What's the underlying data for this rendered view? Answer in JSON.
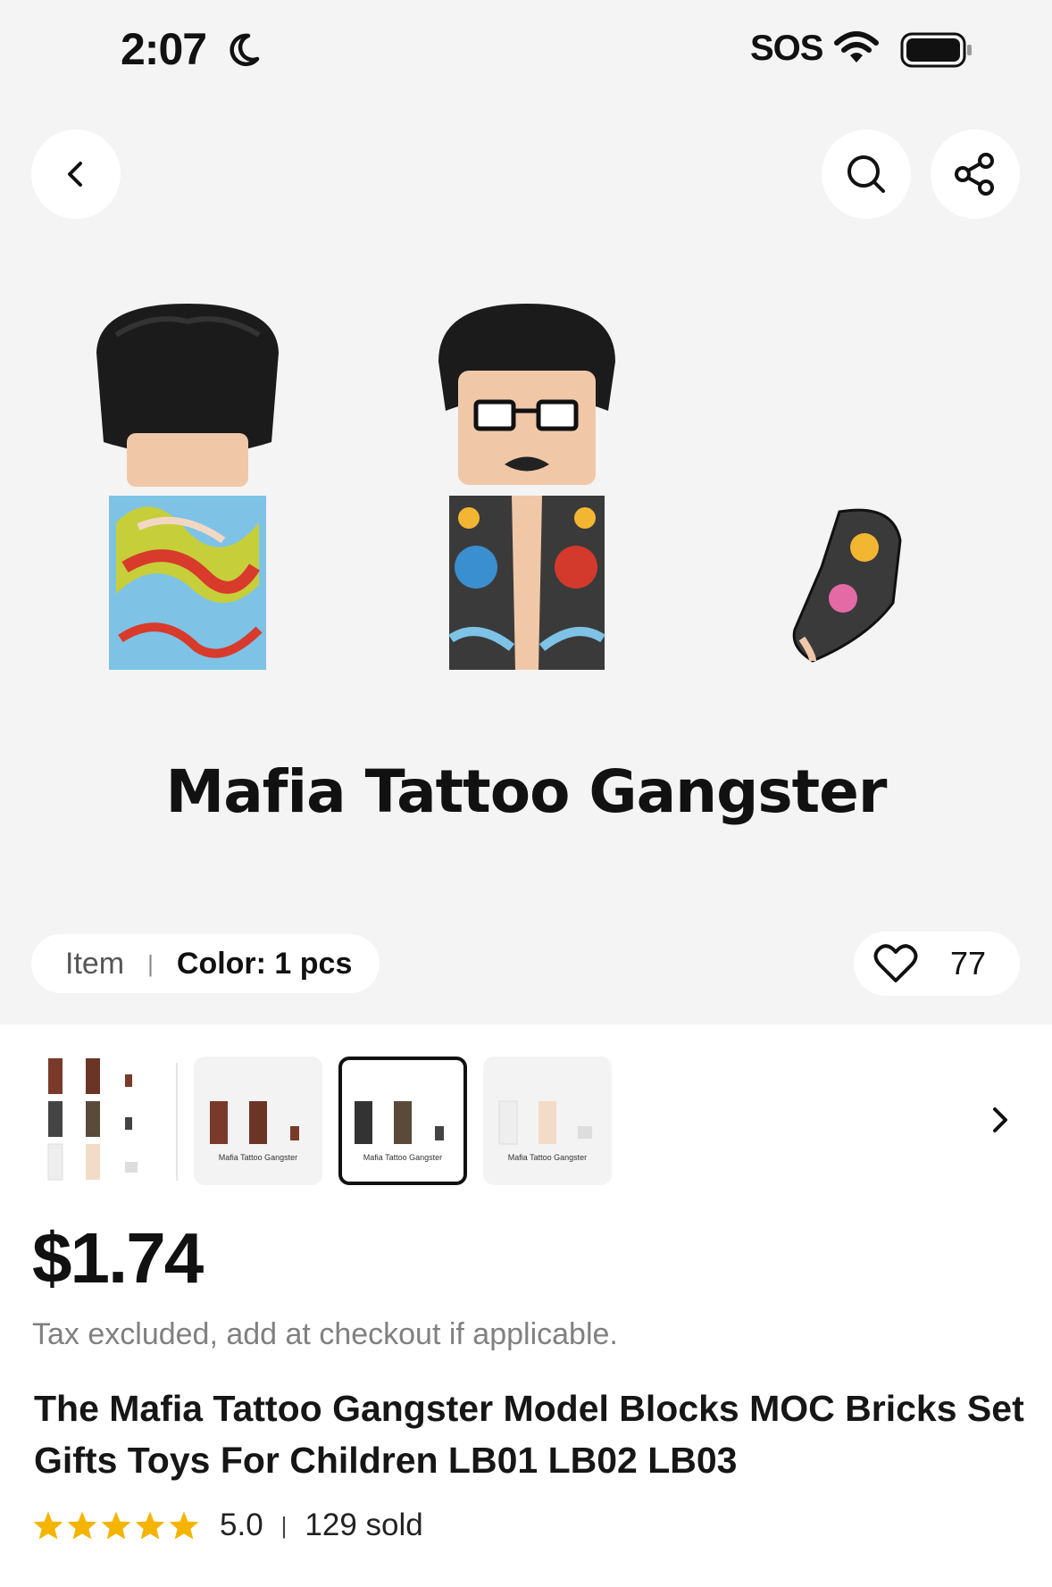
{
  "status_bar": {
    "time": "2:07",
    "carrier": "SOS"
  },
  "nav": {
    "back_icon": "chevron-left-icon",
    "search_icon": "search-icon",
    "share_icon": "share-icon"
  },
  "hero": {
    "product_title": "Mafia Tattoo Gangster"
  },
  "variant": {
    "item_label": "Item",
    "separator": "|",
    "color_label": "Color: 1 pcs"
  },
  "favorites": {
    "count": "77",
    "icon": "heart-outline-icon"
  },
  "thumbnails": [
    {
      "caption": "",
      "selected": false
    },
    {
      "caption": "Mafia Tattoo Gangster",
      "selected": false
    },
    {
      "caption": "Mafia Tattoo Gangster",
      "selected": true
    },
    {
      "caption": "Mafia Tattoo Gangster",
      "selected": false
    }
  ],
  "price": "$1.74",
  "tax_note": "Tax excluded, add at checkout if applicable.",
  "product_name": "The Mafia Tattoo Gangster Model Blocks MOC Bricks Set Gifts Toys For Children LB01 LB02 LB03",
  "rating": {
    "stars": 5,
    "value": "5.0",
    "separator": "|",
    "sold": "129 sold"
  },
  "colors": {
    "star": "#f4b400",
    "hero_bg": "#f4f4f4",
    "text": "#111111",
    "muted": "#808080"
  }
}
